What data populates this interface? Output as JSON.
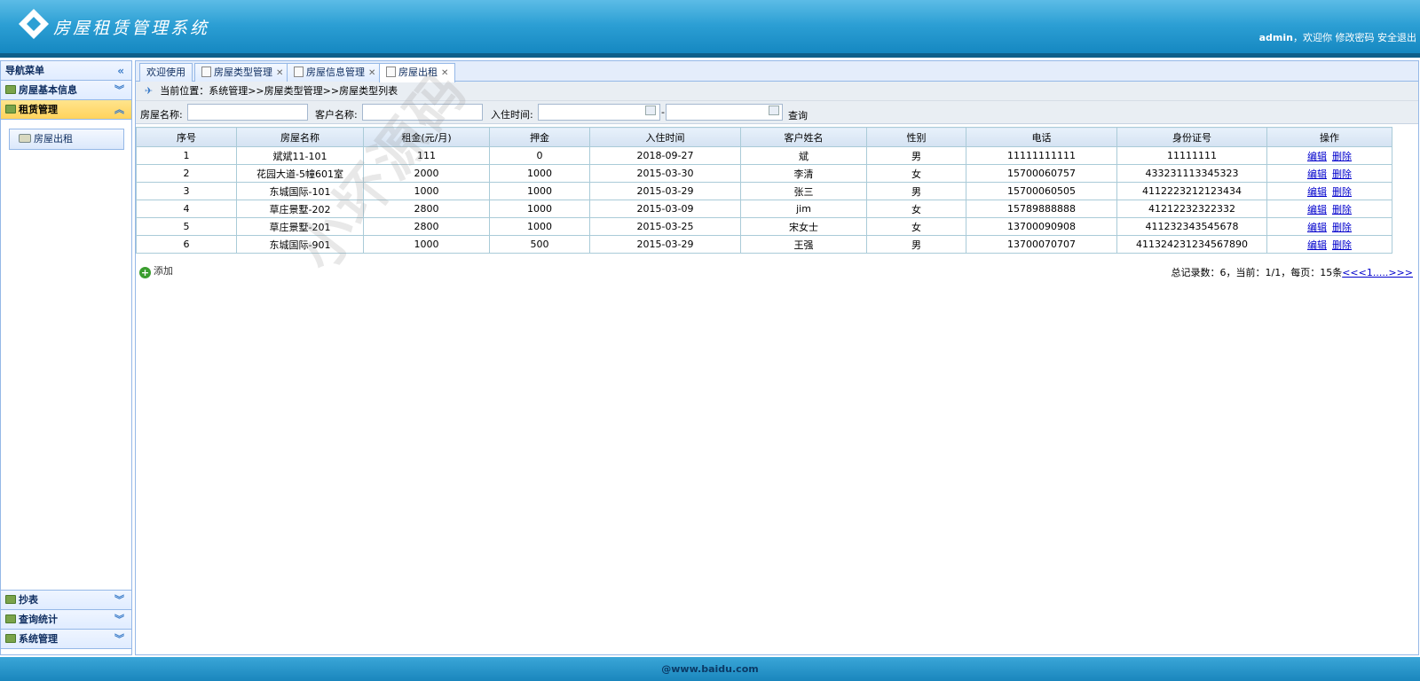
{
  "header": {
    "app_title": "房屋租赁管理系统",
    "user_name": "admin",
    "welcome": "，欢迎你",
    "change_password": "修改密码",
    "logout": "安全退出"
  },
  "sidebar": {
    "title": "导航菜单",
    "sections": [
      {
        "label": "房屋基本信息"
      },
      {
        "label": "租赁管理",
        "items": [
          {
            "label": "房屋出租"
          }
        ]
      },
      {
        "label": "抄表"
      },
      {
        "label": "查询统计"
      },
      {
        "label": "系统管理"
      }
    ]
  },
  "tabs": [
    {
      "label": "欢迎使用"
    },
    {
      "label": "房屋类型管理"
    },
    {
      "label": "房屋信息管理"
    },
    {
      "label": "房屋出租"
    }
  ],
  "breadcrumb": "当前位置：系统管理>>房屋类型管理>>房屋类型列表",
  "filters": {
    "house_name_label": "房屋名称:",
    "customer_name_label": "客户名称:",
    "checkin_label": "入住时间:",
    "dash": "-",
    "query_label": "查询"
  },
  "table": {
    "headers": [
      "序号",
      "房屋名称",
      "租金(元/月)",
      "押金",
      "入住时间",
      "客户姓名",
      "性别",
      "电话",
      "身份证号",
      "操作"
    ],
    "rows": [
      [
        "1",
        "斌斌11-101",
        "111",
        "0",
        "2018-09-27",
        "斌",
        "男",
        "11111111111",
        "11111111"
      ],
      [
        "2",
        "花园大道-5幢601室",
        "2000",
        "1000",
        "2015-03-30",
        "李清",
        "女",
        "15700060757",
        "433231113345323"
      ],
      [
        "3",
        "东城国际-101",
        "1000",
        "1000",
        "2015-03-29",
        "张三",
        "男",
        "15700060505",
        "4112223212123434"
      ],
      [
        "4",
        "草庄景墅-202",
        "2800",
        "1000",
        "2015-03-09",
        "jim",
        "女",
        "15789888888",
        "41212232322332"
      ],
      [
        "5",
        "草庄景墅-201",
        "2800",
        "1000",
        "2015-03-25",
        "宋女士",
        "女",
        "13700090908",
        "411232343545678"
      ],
      [
        "6",
        "东城国际-901",
        "1000",
        "500",
        "2015-03-29",
        "王强",
        "男",
        "13700070707",
        "411324231234567890"
      ]
    ],
    "edit_label": "编辑",
    "delete_label": "删除"
  },
  "add_label": "添加",
  "pager": {
    "summary": "总记录数：6，当前：1/1，每页：15条",
    "links": "<<<1.....>>>"
  },
  "watermark": "小坏源码",
  "footer": "@www.baidu.com",
  "colors": {
    "header": "#2c9fd4",
    "accent_active": "#ffd35c",
    "border": "#95b8e7"
  }
}
